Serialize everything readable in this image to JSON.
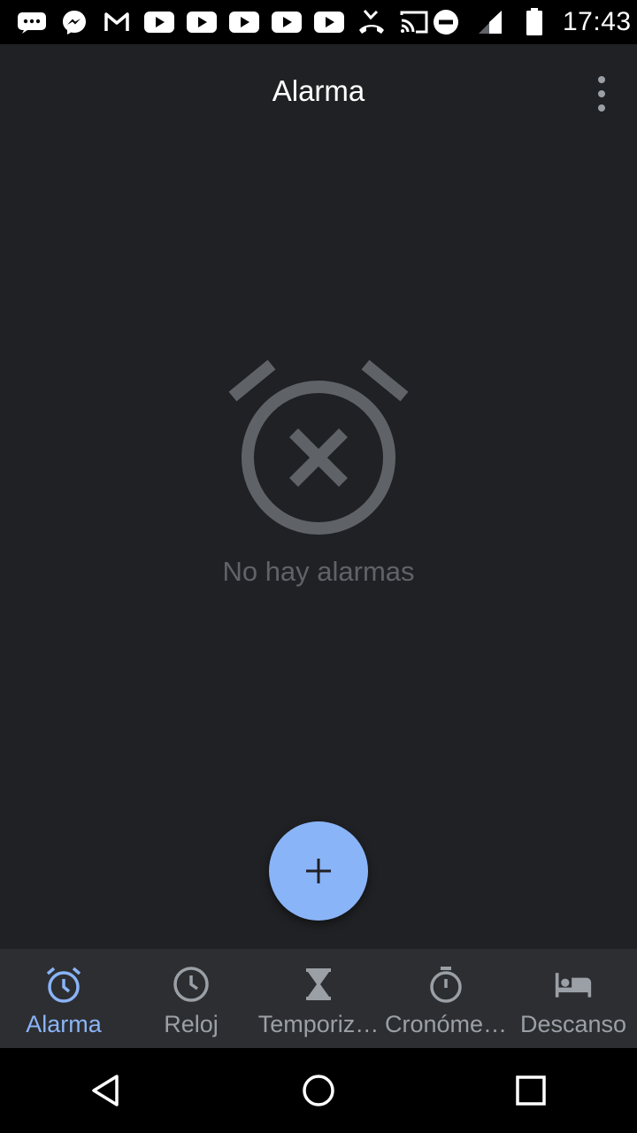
{
  "status_bar": {
    "time": "17:43",
    "icons_left": [
      "more-notifications-icon",
      "messenger-icon",
      "gmail-icon",
      "youtube-icon",
      "youtube-icon",
      "youtube-icon",
      "youtube-icon",
      "youtube-icon",
      "missed-call-icon",
      "cast-icon"
    ],
    "icons_right": [
      "do-not-disturb-icon",
      "signal-icon",
      "battery-icon"
    ]
  },
  "app_bar": {
    "title": "Alarma"
  },
  "empty_state": {
    "message": "No hay alarmas"
  },
  "fab": {
    "icon": "add-icon"
  },
  "bottom_nav": {
    "active_index": 0,
    "tabs": [
      {
        "label": "Alarma",
        "icon": "alarm-icon"
      },
      {
        "label": "Reloj",
        "icon": "clock-icon"
      },
      {
        "label": "Temporiz…",
        "icon": "hourglass-icon"
      },
      {
        "label": "Cronóme…",
        "icon": "stopwatch-icon"
      },
      {
        "label": "Descanso",
        "icon": "bed-icon"
      }
    ]
  },
  "colors": {
    "background": "#202124",
    "accent": "#8ab4f8",
    "inactive": "#9aa0a6",
    "empty_icon": "#5f6368"
  }
}
